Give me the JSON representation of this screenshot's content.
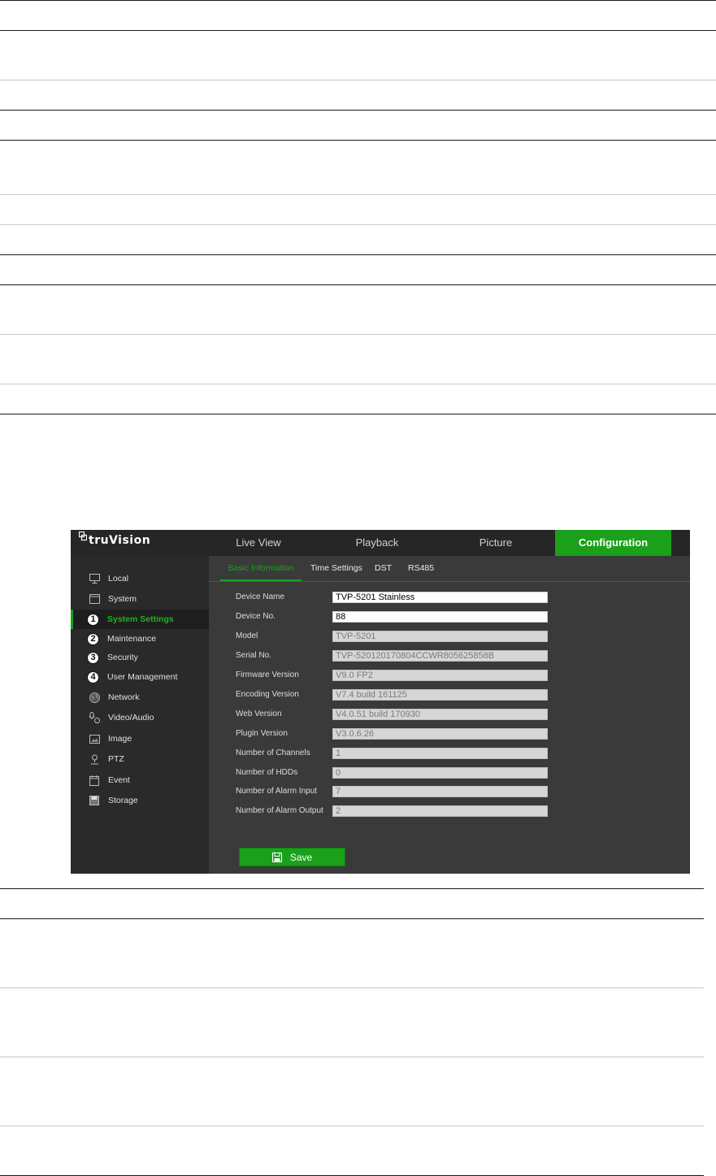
{
  "app": {
    "logo": "truVision",
    "nav_tabs": [
      {
        "label": "Live View"
      },
      {
        "label": "Playback"
      },
      {
        "label": "Picture"
      },
      {
        "label": "Configuration",
        "active": true
      }
    ],
    "sidebar": {
      "items": [
        {
          "label": "Local",
          "icon": "monitor-icon"
        },
        {
          "label": "System",
          "icon": "window-icon"
        },
        {
          "label": "System Settings",
          "badge": "1",
          "active": true
        },
        {
          "label": "Maintenance",
          "badge": "2"
        },
        {
          "label": "Security",
          "badge": "3"
        },
        {
          "label": "User Management",
          "badge": "4"
        },
        {
          "label": "Network",
          "icon": "globe-icon"
        },
        {
          "label": "Video/Audio",
          "icon": "microphone-camera-icon"
        },
        {
          "label": "Image",
          "icon": "image-icon"
        },
        {
          "label": "PTZ",
          "icon": "ptz-camera-icon"
        },
        {
          "label": "Event",
          "icon": "calendar-icon"
        },
        {
          "label": "Storage",
          "icon": "disk-icon"
        }
      ]
    },
    "sub_tabs": [
      {
        "label": "Basic Information",
        "active": true
      },
      {
        "label": "Time Settings"
      },
      {
        "label": "DST"
      },
      {
        "label": "RS485"
      }
    ],
    "fields": [
      {
        "label": "Device Name",
        "value": "TVP-5201 Stainless",
        "editable": true
      },
      {
        "label": "Device No.",
        "value": "88",
        "editable": true
      },
      {
        "label": "Model",
        "value": "TVP-5201",
        "editable": false
      },
      {
        "label": "Serial No.",
        "value": "TVP-520120170804CCWR805625858B",
        "editable": false
      },
      {
        "label": "Firmware Version",
        "value": "V9.0 FP2",
        "editable": false
      },
      {
        "label": "Encoding Version",
        "value": "V7.4 build 161125",
        "editable": false
      },
      {
        "label": "Web Version",
        "value": "V4.0.51 build 170930",
        "editable": false
      },
      {
        "label": "Plugin Version",
        "value": "V3.0.6.26",
        "editable": false
      },
      {
        "label": "Number of Channels",
        "value": "1",
        "editable": false
      },
      {
        "label": "Number of HDDs",
        "value": "0",
        "editable": false
      },
      {
        "label": "Number of Alarm Input",
        "value": "7",
        "editable": false
      },
      {
        "label": "Number of Alarm Output",
        "value": "2",
        "editable": false
      }
    ],
    "save_label": "Save",
    "colors": {
      "accent": "#1aa01a",
      "bar": "#262626",
      "sidebar": "#2a2a2a",
      "panel": "#3a3a3a"
    }
  }
}
